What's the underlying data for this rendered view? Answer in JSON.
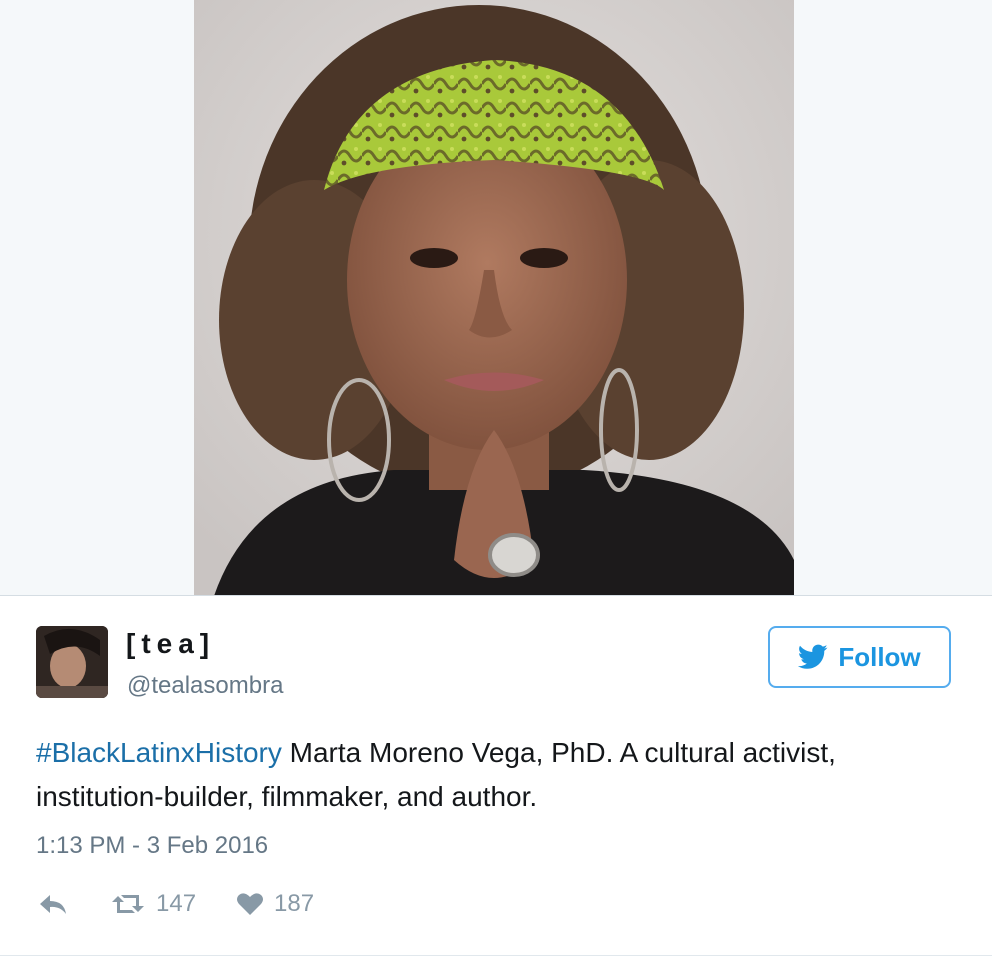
{
  "tweet": {
    "display_name": "[tea]",
    "handle": "@tealasombra",
    "follow_label": "Follow",
    "hashtag": "#BlackLatinxHistory",
    "body": " Marta Moreno Vega, PhD. A cultural activist, institution-builder, filmmaker, and author.",
    "timestamp": "1:13 PM - 3 Feb 2016",
    "retweet_count": "147",
    "like_count": "187"
  },
  "icons": {
    "follow": "twitter-bird-icon",
    "reply": "reply-icon",
    "retweet": "retweet-icon",
    "like": "heart-icon"
  },
  "colors": {
    "accent": "#1b95e0",
    "hashtag": "#1b6fa8",
    "muted": "#657786",
    "icon": "#8899a6"
  }
}
